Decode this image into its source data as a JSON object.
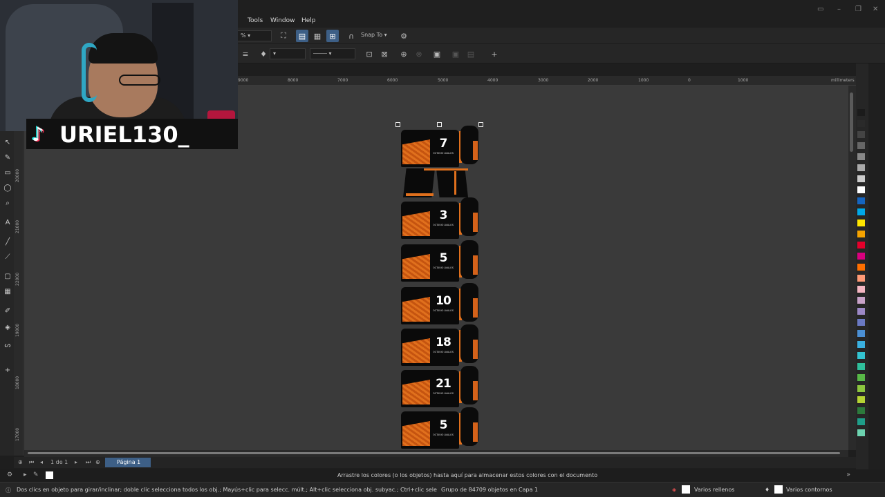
{
  "menu": [
    "Tools",
    "Window",
    "Help"
  ],
  "toolbar": {
    "zoom_value": "%",
    "snap_label": "Snap To"
  },
  "ruler": {
    "h_ticks": [
      "9000",
      "8000",
      "7000",
      "6000",
      "5000",
      "4000",
      "3000",
      "2000",
      "1000",
      "0",
      "1000"
    ],
    "units": "millimeters",
    "v_ticks": [
      "20000",
      "21000",
      "22000",
      "19000",
      "18000",
      "17000"
    ]
  },
  "jerseys": [
    {
      "number": "7",
      "name": "OCTAVIO AVALOS"
    },
    {
      "number": "3",
      "name": "OCTAVIO AVALOS"
    },
    {
      "number": "5",
      "name": "OCTAVIO AVALOS"
    },
    {
      "number": "10",
      "name": "OCTAVIO AVALOS"
    },
    {
      "number": "18",
      "name": "OCTAVIO AVALOS"
    },
    {
      "number": "21",
      "name": "OCTAVIO AVALOS"
    },
    {
      "number": "5",
      "name": "OCTAVIO AVALOS"
    }
  ],
  "pagebar": {
    "page_count": "1 de 1",
    "page_tab": "Página 1"
  },
  "docbar": "Arrastre los colores (o los objetos) hasta aquí para almacenar estos colores con el documento",
  "status": {
    "hint": "Dos clics en objeto para girar/inclinar; doble clic selecciona todos los obj.; Mayús+clic para selecc. múlt.; Alt+clic selecciona obj. subyac.; Ctrl+clic selecciona obj. de grupo",
    "selection": "Grupo de 84709 objetos en Capa 1",
    "fill": "Varios rellenos",
    "outline": "Varios contornos"
  },
  "overlay": {
    "tiktok_handle": "URIEL130_"
  },
  "palette_colors": [
    "#1b1b1b",
    "#2a2a2a",
    "#444444",
    "#666666",
    "#888888",
    "#aaaaaa",
    "#cccccc",
    "#ffffff",
    "#1565c0",
    "#00a8e8",
    "#ffe600",
    "#f5a300",
    "#e4002b",
    "#d9007e",
    "#ff6f00",
    "#ff9a76",
    "#f4b6c2",
    "#c8a2c8",
    "#9c88c6",
    "#6a79c3",
    "#4b8fd4",
    "#3ab0e0",
    "#33c3d0",
    "#2fbf9b",
    "#58b947",
    "#8cc63f",
    "#b5d334",
    "#2c7a3c",
    "#1f9e89",
    "#6dd3b0"
  ]
}
